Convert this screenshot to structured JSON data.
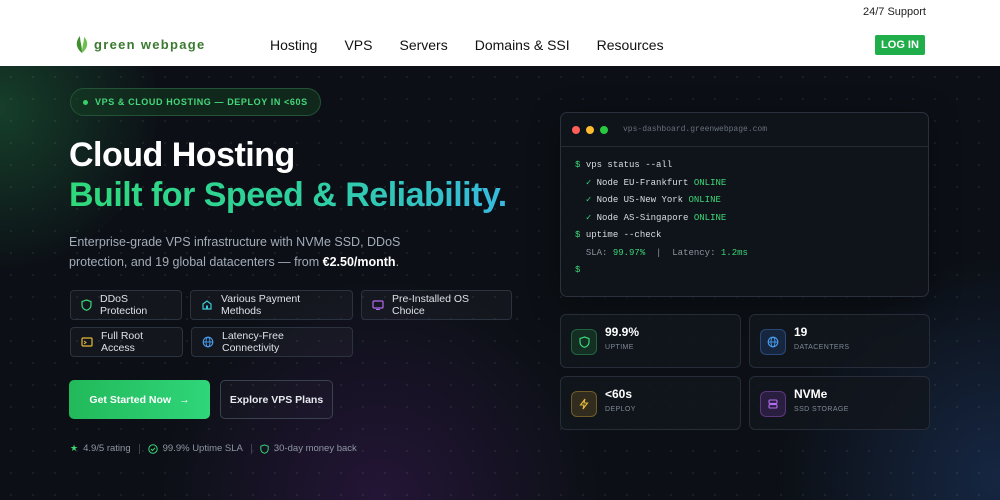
{
  "header": {
    "support": "24/7 Support",
    "logo_text": "Green Webpage",
    "nav": [
      "Hosting",
      "VPS",
      "Servers",
      "Domains & SSI",
      "Resources"
    ],
    "login": "LOG IN"
  },
  "hero": {
    "badge": "VPS & CLOUD HOSTING — DEPLOY IN <60S",
    "title_line1": "Cloud Hosting",
    "title_line2": "Built for Speed & Reliability.",
    "description_prefix": "Enterprise-grade VPS infrastructure with NVMe SSD, DDoS protection, and 19 global datacenters — from ",
    "description_price": "€2.50/month",
    "description_suffix": ".",
    "features": [
      {
        "label": "DDoS Protection",
        "icon": "shield-icon"
      },
      {
        "label": "Various Payment Methods",
        "icon": "wallet-icon"
      },
      {
        "label": "Pre-Installed OS Choice",
        "icon": "monitor-icon"
      },
      {
        "label": "Full Root Access",
        "icon": "terminal-icon"
      },
      {
        "label": "Latency-Free Connectivity",
        "icon": "globe-icon"
      }
    ],
    "cta_primary": "Get Started Now",
    "cta_secondary": "Explore VPS Plans",
    "trust": [
      "4.9/5 rating",
      "99.9% Uptime SLA",
      "30-day money back"
    ]
  },
  "terminal": {
    "url": "vps-dashboard.greenwebpage.com",
    "prompt": "$",
    "cmd1": "vps status --all",
    "nodes": [
      {
        "name": "Node EU-Frankfurt",
        "status": "ONLINE"
      },
      {
        "name": "Node US-New York",
        "status": "ONLINE"
      },
      {
        "name": "Node AS-Singapore",
        "status": "ONLINE"
      }
    ],
    "check_mark": "✓",
    "cmd2": "uptime --check",
    "sla_label": "SLA:",
    "sla_value": "99.97%",
    "latency_label": "Latency:",
    "latency_value": "1.2ms",
    "separator": "|"
  },
  "stats": [
    {
      "value": "99.9%",
      "label": "UPTIME",
      "icon": "shield-icon"
    },
    {
      "value": "19",
      "label": "DATACENTERS",
      "icon": "globe-icon"
    },
    {
      "value": "<60s",
      "label": "DEPLOY",
      "icon": "bolt-icon"
    },
    {
      "value": "NVMe",
      "label": "SSD STORAGE",
      "icon": "storage-icon"
    }
  ],
  "colors": {
    "brand_green": "#1fae4a",
    "accent_green": "#3bd776",
    "background": "#0c1016"
  }
}
